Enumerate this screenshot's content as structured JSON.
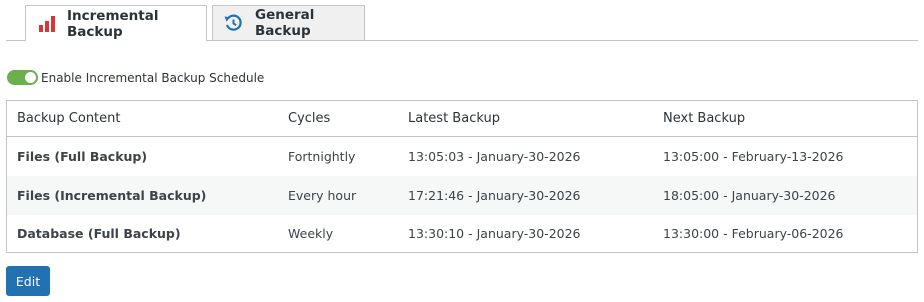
{
  "colors": {
    "accent": "#2271b1",
    "toggle_on": "#6ab04c",
    "chart_icon": "#d63638",
    "history_icon": "#2271b1"
  },
  "tabs": [
    {
      "label": "Incremental Backup",
      "icon": "bar-chart-icon",
      "active": true
    },
    {
      "label": "General Backup",
      "icon": "history-icon",
      "active": false
    }
  ],
  "schedule_toggle": {
    "label": "Enable Incremental Backup Schedule",
    "checked": true
  },
  "table": {
    "headers": [
      "Backup Content",
      "Cycles",
      "Latest Backup",
      "Next Backup"
    ],
    "rows": [
      {
        "content": "Files (Full Backup)",
        "cycle": "Fortnightly",
        "latest": "13:05:03 - January-30-2026",
        "next": "13:05:00 - February-13-2026"
      },
      {
        "content": "Files (Incremental Backup)",
        "cycle": "Every hour",
        "latest": "17:21:46 - January-30-2026",
        "next": "18:05:00 - January-30-2026"
      },
      {
        "content": "Database (Full Backup)",
        "cycle": "Weekly",
        "latest": "13:30:10 - January-30-2026",
        "next": "13:30:00 - February-06-2026"
      }
    ]
  },
  "edit_button": {
    "label": "Edit"
  }
}
